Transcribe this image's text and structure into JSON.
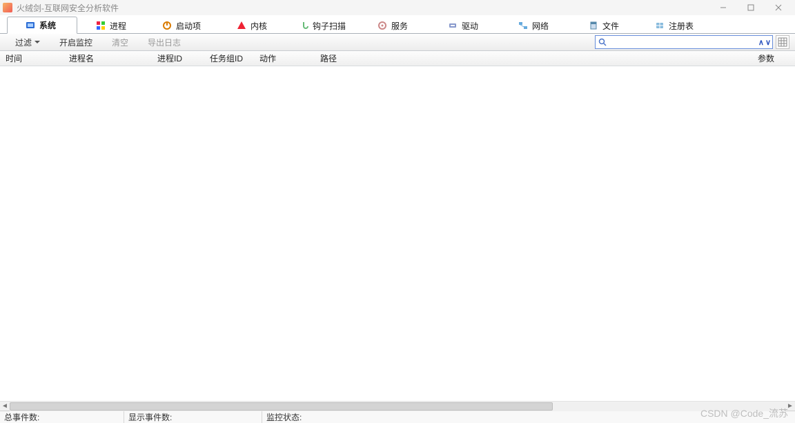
{
  "window": {
    "title": "火绒剑-互联网安全分析软件"
  },
  "tabs": [
    {
      "label": "系统",
      "icon": "system-icon",
      "active": true
    },
    {
      "label": "进程",
      "icon": "process-icon",
      "active": false
    },
    {
      "label": "启动项",
      "icon": "startup-icon",
      "active": false
    },
    {
      "label": "内核",
      "icon": "kernel-icon",
      "active": false
    },
    {
      "label": "钩子扫描",
      "icon": "hook-icon",
      "active": false
    },
    {
      "label": "服务",
      "icon": "service-icon",
      "active": false
    },
    {
      "label": "驱动",
      "icon": "driver-icon",
      "active": false
    },
    {
      "label": "网络",
      "icon": "network-icon",
      "active": false
    },
    {
      "label": "文件",
      "icon": "file-icon",
      "active": false
    },
    {
      "label": "注册表",
      "icon": "registry-icon",
      "active": false
    }
  ],
  "toolbar": {
    "filter_label": "过滤",
    "start_monitor_label": "开启监控",
    "clear_label": "清空",
    "export_log_label": "导出日志",
    "search_value": "",
    "search_placeholder": ""
  },
  "columns": {
    "time": "时间",
    "process_name": "进程名",
    "process_id": "进程ID",
    "task_group_id": "任务组ID",
    "action": "动作",
    "path": "路径",
    "params": "参数"
  },
  "rows": [],
  "status": {
    "total_events_label": "总事件数:",
    "total_events_value": "",
    "shown_events_label": "显示事件数:",
    "shown_events_value": "",
    "monitor_state_label": "监控状态:",
    "monitor_state_value": ""
  },
  "watermark": "CSDN @Code_流苏"
}
